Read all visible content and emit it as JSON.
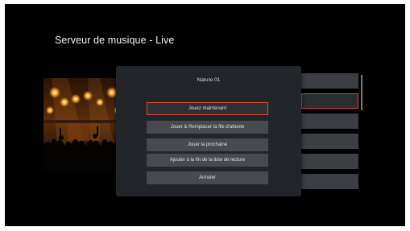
{
  "screen": {
    "title": "Serveur de musique - Live"
  },
  "dialog": {
    "title": "Nature 01",
    "options": [
      {
        "label": "Jouez maintenant",
        "focused": true
      },
      {
        "label": "Jouer & Remplacer la file d'attente",
        "focused": false
      },
      {
        "label": "Jouer la prochaine",
        "focused": false
      },
      {
        "label": "Ajouter à la fin de la liste de lecture",
        "focused": false
      },
      {
        "label": "Annuler",
        "focused": false
      }
    ]
  },
  "colors": {
    "focus_outline": "#d9502b",
    "dialog_bg": "#22262a",
    "option_bg": "#474b50",
    "screen_bg": "#000000"
  },
  "icons": {
    "album_art": "concert-stage-image"
  }
}
